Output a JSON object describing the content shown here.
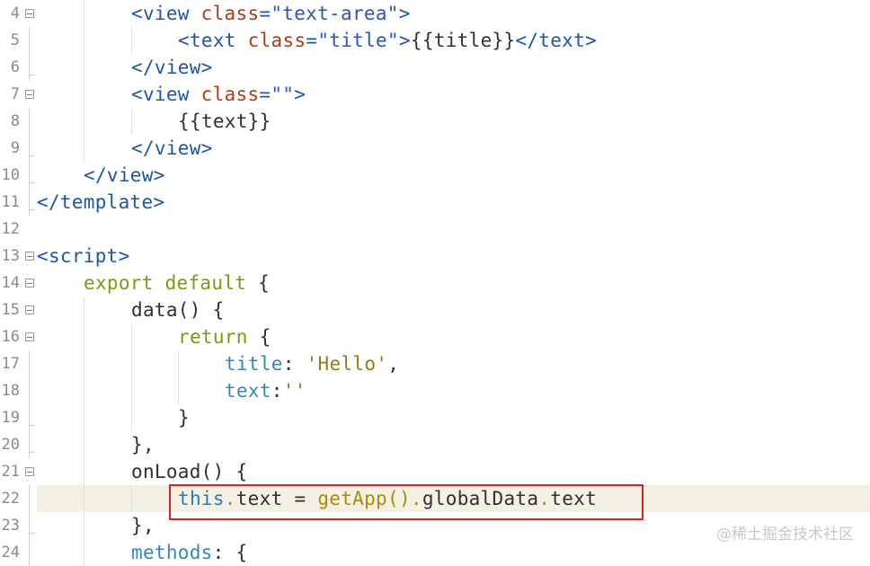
{
  "editor": {
    "lines": [
      {
        "num": "4",
        "tokens": [
          {
            "t": "<view ",
            "c": "tag"
          },
          {
            "t": "class",
            "c": "attr"
          },
          {
            "t": "=",
            "c": "tag"
          },
          {
            "t": "\"text-area\"",
            "c": "str"
          },
          {
            "t": ">",
            "c": "tag"
          }
        ]
      },
      {
        "num": "5",
        "tokens": [
          {
            "t": "<text ",
            "c": "tag"
          },
          {
            "t": "class",
            "c": "attr"
          },
          {
            "t": "=",
            "c": "tag"
          },
          {
            "t": "\"title\"",
            "c": "str"
          },
          {
            "t": ">",
            "c": "tag"
          },
          {
            "t": "{{title}}",
            "c": "plain"
          },
          {
            "t": "</text>",
            "c": "tag"
          }
        ]
      },
      {
        "num": "6",
        "tokens": [
          {
            "t": "</view>",
            "c": "tag"
          }
        ]
      },
      {
        "num": "7",
        "tokens": [
          {
            "t": "<view ",
            "c": "tag"
          },
          {
            "t": "class",
            "c": "attr"
          },
          {
            "t": "=",
            "c": "tag"
          },
          {
            "t": "\"\"",
            "c": "str"
          },
          {
            "t": ">",
            "c": "tag"
          }
        ]
      },
      {
        "num": "8",
        "tokens": [
          {
            "t": "{{text}}",
            "c": "plain"
          }
        ]
      },
      {
        "num": "9",
        "tokens": [
          {
            "t": "</view>",
            "c": "tag"
          }
        ]
      },
      {
        "num": "10",
        "tokens": [
          {
            "t": "</view>",
            "c": "tag"
          }
        ]
      },
      {
        "num": "11",
        "tokens": [
          {
            "t": "</template>",
            "c": "tag"
          }
        ]
      },
      {
        "num": "12",
        "tokens": []
      },
      {
        "num": "13",
        "tokens": [
          {
            "t": "<script>",
            "c": "tag"
          }
        ]
      },
      {
        "num": "14",
        "tokens": [
          {
            "t": "export default ",
            "c": "kw"
          },
          {
            "t": "{",
            "c": "plain"
          }
        ]
      },
      {
        "num": "15",
        "tokens": [
          {
            "t": "data() {",
            "c": "plain"
          }
        ]
      },
      {
        "num": "16",
        "tokens": [
          {
            "t": "return ",
            "c": "kw"
          },
          {
            "t": "{",
            "c": "plain"
          }
        ]
      },
      {
        "num": "17",
        "tokens": [
          {
            "t": "title",
            "c": "key"
          },
          {
            "t": ": ",
            "c": "plain"
          },
          {
            "t": "'Hello'",
            "c": "sq"
          },
          {
            "t": ",",
            "c": "plain"
          }
        ]
      },
      {
        "num": "18",
        "tokens": [
          {
            "t": "text",
            "c": "key"
          },
          {
            "t": ":",
            "c": "plain"
          },
          {
            "t": "''",
            "c": "sq"
          }
        ]
      },
      {
        "num": "19",
        "tokens": [
          {
            "t": "}",
            "c": "plain"
          }
        ]
      },
      {
        "num": "20",
        "tokens": [
          {
            "t": "},",
            "c": "plain"
          }
        ]
      },
      {
        "num": "21",
        "tokens": [
          {
            "t": "onLoad() {",
            "c": "plain"
          }
        ]
      },
      {
        "num": "22",
        "tokens": [
          {
            "t": "this",
            "c": "this"
          },
          {
            "t": ".",
            "c": "dot"
          },
          {
            "t": "text = ",
            "c": "plain"
          },
          {
            "t": "getApp",
            "c": "fn"
          },
          {
            "t": "().",
            "c": "dot"
          },
          {
            "t": "globalData",
            "c": "plain"
          },
          {
            "t": ".",
            "c": "dot"
          },
          {
            "t": "text",
            "c": "plain"
          }
        ]
      },
      {
        "num": "23",
        "tokens": [
          {
            "t": "},",
            "c": "plain"
          }
        ]
      },
      {
        "num": "24",
        "tokens": [
          {
            "t": "methods",
            "c": "key"
          },
          {
            "t": ": {",
            "c": "plain"
          }
        ]
      }
    ]
  },
  "watermark": "@稀土掘金技术社区"
}
